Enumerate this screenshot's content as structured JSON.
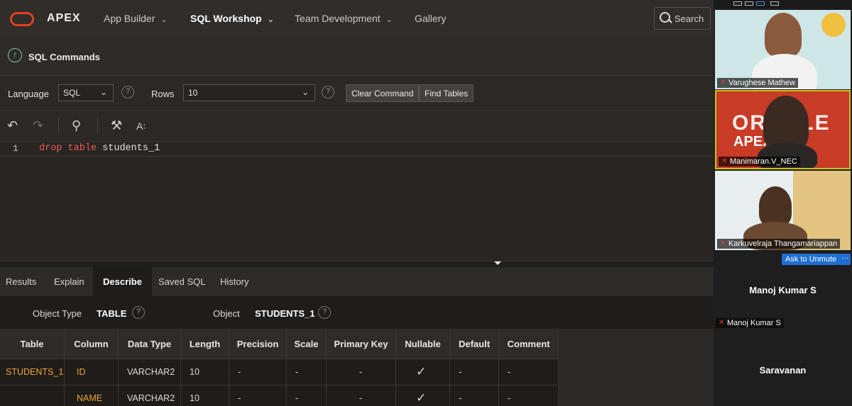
{
  "nav": {
    "brand": "APEX",
    "items": [
      {
        "label": "App Builder",
        "chevron": true
      },
      {
        "label": "SQL Workshop",
        "chevron": true,
        "active": true
      },
      {
        "label": "Team Development",
        "chevron": true
      },
      {
        "label": "Gallery",
        "chevron": false
      }
    ],
    "search_label": "Search"
  },
  "page": {
    "title": "SQL Commands"
  },
  "options": {
    "language_label": "Language",
    "language_value": "SQL",
    "rows_label": "Rows",
    "rows_value": "10",
    "clear_button": "Clear Command",
    "find_button": "Find Tables"
  },
  "editor": {
    "line_number": "1",
    "keyword1": "drop",
    "keyword2": "table",
    "identifier": "students_1"
  },
  "results_tabs": [
    "Results",
    "Explain",
    "Describe",
    "Saved SQL",
    "History"
  ],
  "active_tab": "Describe",
  "describe": {
    "object_type_label": "Object Type",
    "object_type_value": "TABLE",
    "object_label": "Object",
    "object_value": "STUDENTS_1"
  },
  "table": {
    "headers": [
      "Table",
      "Column",
      "Data Type",
      "Length",
      "Precision",
      "Scale",
      "Primary Key",
      "Nullable",
      "Default",
      "Comment"
    ],
    "rows": [
      [
        "STUDENTS_1",
        "ID",
        "VARCHAR2",
        "10",
        "-",
        "-",
        "-",
        "✓",
        "-",
        "-"
      ],
      [
        "",
        "NAME",
        "VARCHAR2",
        "10",
        "-",
        "-",
        "-",
        "✓",
        "-",
        "-"
      ]
    ]
  },
  "video": {
    "participants": [
      {
        "name": "Varughese Mathew"
      },
      {
        "name": "Manimaran.V_NEC"
      },
      {
        "name": "Karkuvelraja Thangamariappan"
      }
    ],
    "ask_to_unmute": "Ask to Unmute",
    "more": "···",
    "manoj_big": "Manoj Kumar S",
    "manoj_small": "Manoj Kumar S",
    "saravanan": "Saravanan",
    "tile2_sign_top": "ORACLE",
    "tile2_sign_bottom": "APEX"
  },
  "colors": {
    "accent": "#f0a636",
    "keyword": "#ee5c52",
    "oracle_red": "#e0401f"
  }
}
